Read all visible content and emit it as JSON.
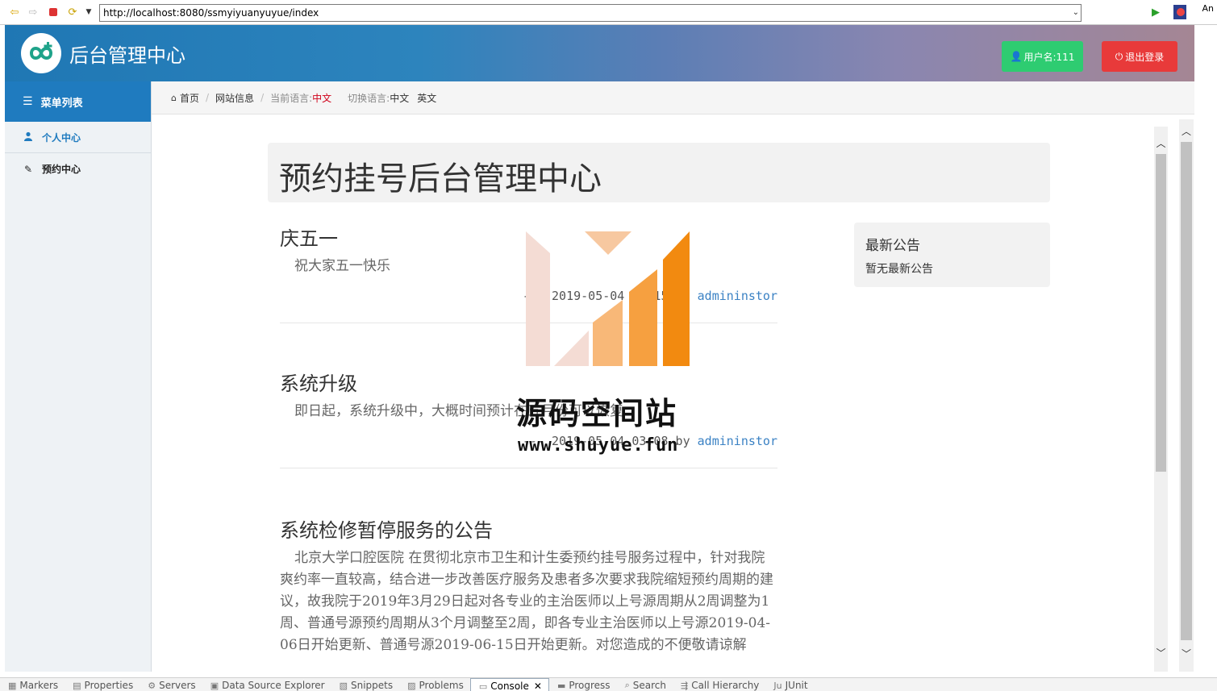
{
  "browser": {
    "url": "http://localhost:8080/ssmyiyuanyuyue/index",
    "corner_text": "An"
  },
  "header": {
    "title": "后台管理中心",
    "user_button": "用户名:111",
    "logout_button": "退出登录"
  },
  "sidebar": {
    "menu_title": "菜单列表",
    "items": [
      {
        "label": "个人中心"
      },
      {
        "label": "预约中心"
      }
    ]
  },
  "breadcrumb": {
    "home": "首页",
    "site_info": "网站信息",
    "current_lang_label": "当前语言:",
    "current_lang": "中文",
    "switch_lang_label": "切换语言:",
    "lang_options": [
      "中文",
      "英文"
    ]
  },
  "main": {
    "jumbotron_title": "预约挂号后台管理中心",
    "notices": [
      {
        "title": "庆五一",
        "body": "祝大家五一快乐",
        "meta_prefix": "--- 2019-05-04 03:15 by ",
        "author": "admininstor"
      },
      {
        "title": "系统升级",
        "body": "即日起，系统升级中，大概时间预计在五月份可以恢复",
        "meta_prefix": "--- 2019-05-04 03:08 by ",
        "author": "admininstor"
      },
      {
        "title": "系统检修暂停服务的公告",
        "body": "北京大学口腔医院 在贯彻北京市卫生和计生委预约挂号服务过程中，针对我院爽约率一直较高，结合进一步改善医疗服务及患者多次要求我院缩短预约周期的建议，故我院于2019年3月29日起对各专业的主治医师以上号源周期从2周调整为1周、普通号源预约周期从3个月调整至2周，即各专业主治医师以上号源2019-04-06日开始更新、普通号源2019-06-15日开始更新。对您造成的不便敬请谅解",
        "meta_prefix": "",
        "author": ""
      }
    ],
    "panel": {
      "title": "最新公告",
      "text": "暂无最新公告"
    }
  },
  "watermark": {
    "name": "源码空间站",
    "url": "www.shuyue.fun"
  },
  "bottom_tabs": [
    {
      "label": "Markers",
      "icon": "markers-icon"
    },
    {
      "label": "Properties",
      "icon": "properties-icon"
    },
    {
      "label": "Servers",
      "icon": "servers-icon"
    },
    {
      "label": "Data Source Explorer",
      "icon": "datasource-icon"
    },
    {
      "label": "Snippets",
      "icon": "snippets-icon"
    },
    {
      "label": "Problems",
      "icon": "problems-icon"
    },
    {
      "label": "Console",
      "icon": "console-icon",
      "active": true
    },
    {
      "label": "Progress",
      "icon": "progress-icon"
    },
    {
      "label": "Search",
      "icon": "search-icon"
    },
    {
      "label": "Call Hierarchy",
      "icon": "call-hierarchy-icon"
    },
    {
      "label": "JUnit",
      "icon": "junit-icon"
    }
  ],
  "colors": {
    "brand_blue": "#1f7bbf",
    "user_green": "#2ecc71",
    "logout_red": "#e83a3a",
    "link_blue": "#3b82c4",
    "current_lang_red": "#d0021b"
  }
}
